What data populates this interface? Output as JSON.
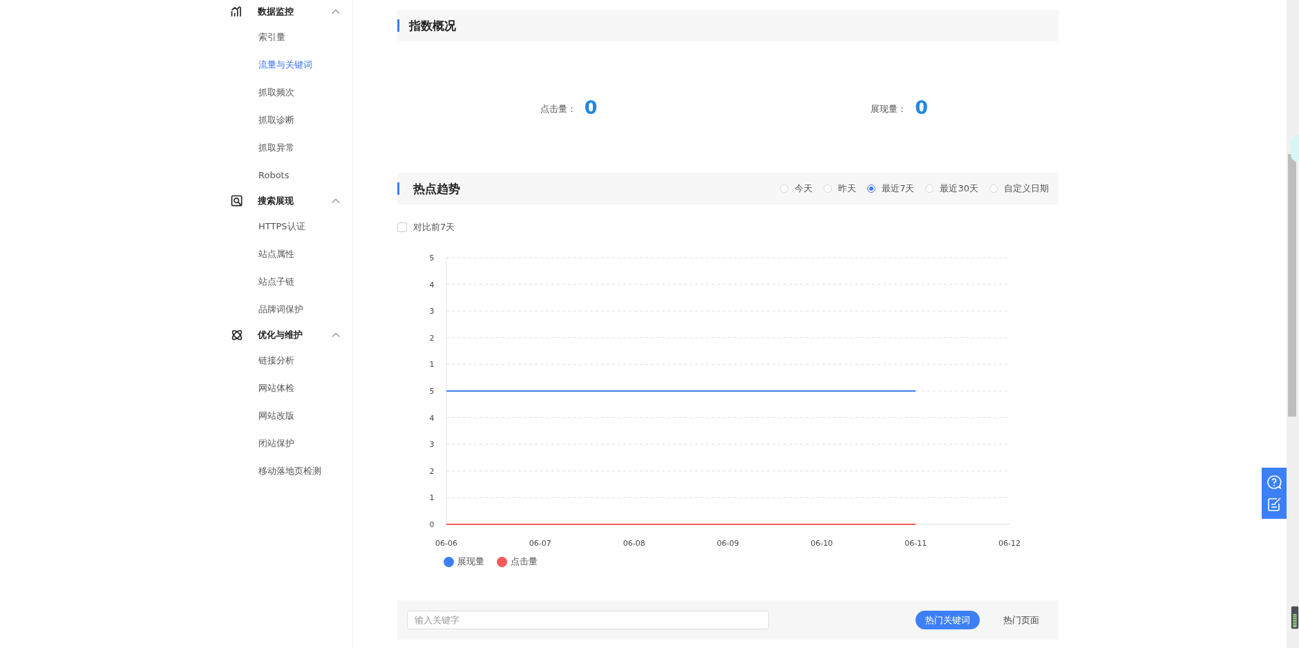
{
  "sidebar": {
    "groups": [
      {
        "title": "数据监控",
        "kind": "chart",
        "expanded": true,
        "items": [
          {
            "label": "索引量",
            "selected": false
          },
          {
            "label": "流量与关键词",
            "selected": true
          },
          {
            "label": "抓取频次",
            "selected": false
          },
          {
            "label": "抓取诊断",
            "selected": false
          },
          {
            "label": "抓取异常",
            "selected": false
          },
          {
            "label": "Robots",
            "selected": false
          }
        ]
      },
      {
        "title": "搜索展现",
        "kind": "search",
        "expanded": true,
        "items": [
          {
            "label": "HTTPS认证",
            "selected": false
          },
          {
            "label": "站点属性",
            "selected": false
          },
          {
            "label": "站点子链",
            "selected": false
          },
          {
            "label": "品牌词保护",
            "selected": false
          }
        ]
      },
      {
        "title": "优化与维护",
        "kind": "atom",
        "expanded": true,
        "items": [
          {
            "label": "链接分析",
            "selected": false
          },
          {
            "label": "网站体检",
            "selected": false
          },
          {
            "label": "网站改版",
            "selected": false
          },
          {
            "label": "闭站保护",
            "selected": false
          },
          {
            "label": "移动落地页检测",
            "selected": false
          }
        ]
      }
    ]
  },
  "overview": {
    "title": "指数概况",
    "stats": [
      {
        "label": "点击量：",
        "value": "0"
      },
      {
        "label": "展现量：",
        "value": "0"
      }
    ]
  },
  "trend": {
    "title": "热点趋势",
    "ranges": [
      {
        "label": "今天",
        "selected": false
      },
      {
        "label": "昨天",
        "selected": false
      },
      {
        "label": "最近7天",
        "selected": true
      },
      {
        "label": "最近30天",
        "selected": false
      },
      {
        "label": "自定义日期",
        "selected": false
      }
    ],
    "compare": {
      "label": "对比前7天",
      "checked": false
    },
    "upper_axis_labels": [
      "5",
      "4",
      "3",
      "2",
      "1"
    ],
    "chart_data": {
      "type": "line",
      "categories": [
        "06-06",
        "06-07",
        "06-08",
        "06-09",
        "06-10",
        "06-11",
        "06-12"
      ],
      "yticks": [
        0,
        1,
        2,
        3,
        4,
        5
      ],
      "ylim": [
        0,
        10
      ],
      "grid": true,
      "legend": "bottom-left",
      "series": [
        {
          "name": "展现量",
          "color": "#3d7ff6",
          "values": [
            5,
            5,
            5,
            5,
            5,
            5,
            null
          ]
        },
        {
          "name": "点击量",
          "color": "#f65a5a",
          "values": [
            0,
            0,
            0,
            0,
            0,
            0,
            null
          ]
        }
      ]
    }
  },
  "keywords": {
    "search": {
      "placeholder": "输入关键字"
    },
    "tabs": [
      {
        "label": "热门关键词",
        "selected": true
      },
      {
        "label": "热门页面",
        "selected": false
      }
    ]
  }
}
